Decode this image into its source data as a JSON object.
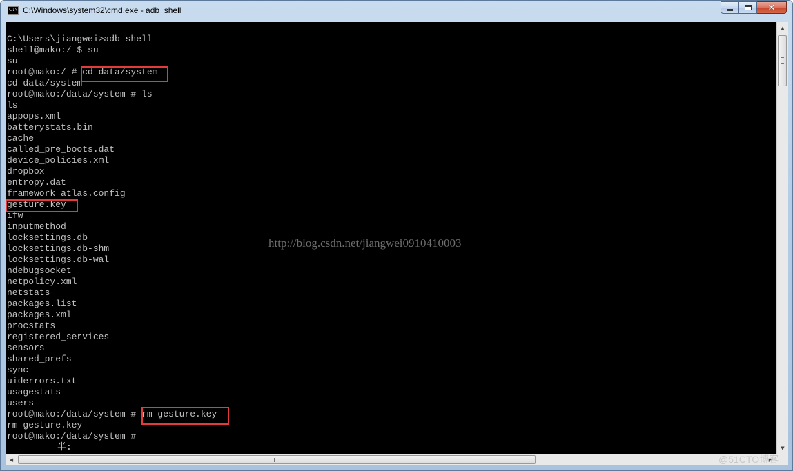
{
  "window": {
    "title": "C:\\Windows\\system32\\cmd.exe - adb  shell",
    "icon_label": "C:\\",
    "icon": "console-window-icon"
  },
  "caption_buttons": {
    "minimize": "minimize-icon",
    "maximize": "maximize-icon",
    "close": "close-icon",
    "close_color": "#c7462b"
  },
  "console": {
    "background": "#000000",
    "foreground": "#c0c0c0",
    "lines": [
      "C:\\Users\\jiangwei>adb shell",
      "shell@mako:/ $ su",
      "su",
      "root@mako:/ # cd data/system",
      "cd data/system",
      "root@mako:/data/system # ls",
      "ls",
      "appops.xml",
      "batterystats.bin",
      "cache",
      "called_pre_boots.dat",
      "device_policies.xml",
      "dropbox",
      "entropy.dat",
      "framework_atlas.config",
      "gesture.key",
      "ifw",
      "inputmethod",
      "locksettings.db",
      "locksettings.db-shm",
      "locksettings.db-wal",
      "ndebugsocket",
      "netpolicy.xml",
      "netstats",
      "packages.list",
      "packages.xml",
      "procstats",
      "registered_services",
      "sensors",
      "shared_prefs",
      "sync",
      "uiderrors.txt",
      "usagestats",
      "users",
      "root@mako:/data/system # rm gesture.key",
      "rm gesture.key",
      "root@mako:/data/system #"
    ],
    "ime_indicator": "半:",
    "highlight_color": "#e33a3a"
  },
  "watermarks": {
    "center": "http://blog.csdn.net/jiangwei0910410003",
    "corner": "@51CTO博客"
  },
  "scrollbars": {
    "up_arrow": "▲",
    "down_arrow": "▼",
    "left_arrow": "◀",
    "right_arrow": "▶"
  }
}
